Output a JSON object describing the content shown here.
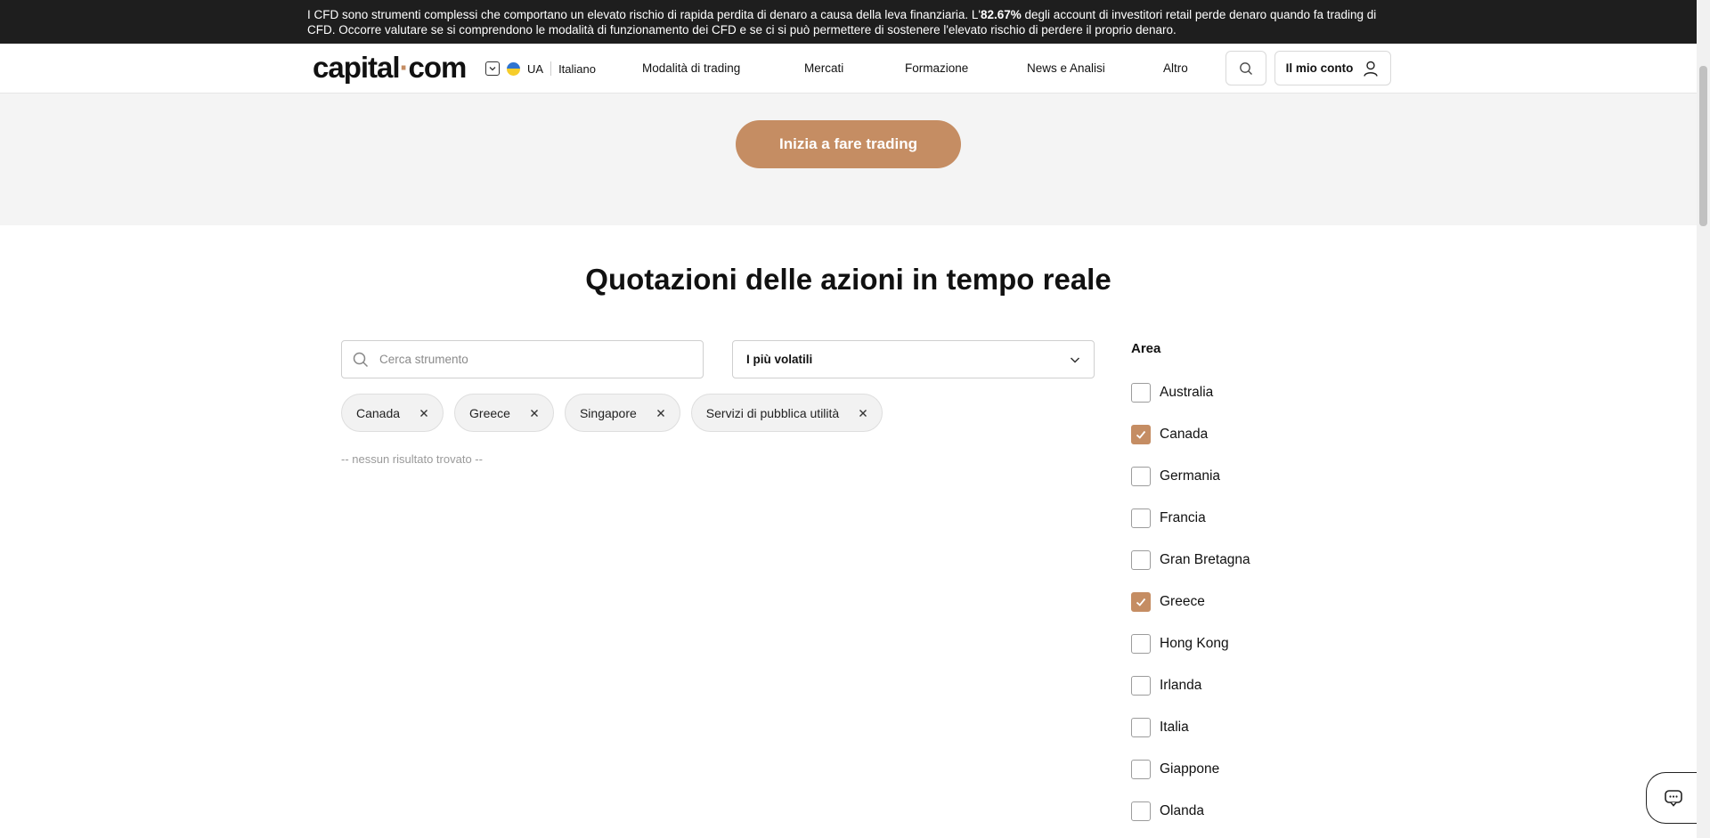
{
  "risk_warning": {
    "before": "I CFD sono strumenti complessi che comportano un elevato rischio di rapida perdita di denaro a causa della leva finanziaria. L'",
    "percent": "82.67%",
    "after": " degli account di investitori retail perde denaro quando fa trading di CFD. Occorre valutare se si comprendono le modalità di funzionamento dei CFD e se ci si può permettere di sostenere l'elevato rischio di perdere il proprio denaro."
  },
  "header": {
    "logo_left": "capital",
    "logo_dot": "·",
    "logo_right": "com",
    "region": "UA",
    "language": "Italiano",
    "nav": [
      "Modalità di trading",
      "Mercati",
      "Formazione",
      "News e Analisi",
      "Altro"
    ],
    "account_label": "Il mio conto"
  },
  "hero": {
    "cta_label": "Inizia a fare trading"
  },
  "main": {
    "title": "Quotazioni delle azioni in tempo reale",
    "search_placeholder": "Cerca strumento",
    "sort_selected": "I più volatili",
    "active_filters": [
      "Canada",
      "Greece",
      "Singapore",
      "Servizi di pubblica utilità"
    ],
    "empty_message": "-- nessun risultato trovato --"
  },
  "filters": {
    "heading": "Area",
    "options": [
      {
        "label": "Australia",
        "checked": false
      },
      {
        "label": "Canada",
        "checked": true
      },
      {
        "label": "Germania",
        "checked": false
      },
      {
        "label": "Francia",
        "checked": false
      },
      {
        "label": "Gran Bretagna",
        "checked": false
      },
      {
        "label": "Greece",
        "checked": true
      },
      {
        "label": "Hong Kong",
        "checked": false
      },
      {
        "label": "Irlanda",
        "checked": false
      },
      {
        "label": "Italia",
        "checked": false
      },
      {
        "label": "Giappone",
        "checked": false
      },
      {
        "label": "Olanda",
        "checked": false
      }
    ]
  },
  "colors": {
    "accent": "#c58d63",
    "topbar": "#1e1e1e",
    "hero_bg": "#f4f4f4"
  }
}
